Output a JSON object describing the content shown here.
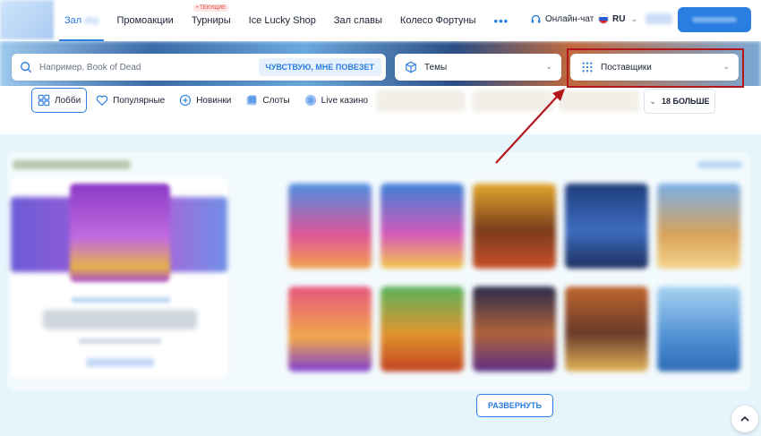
{
  "header": {
    "nav": [
      {
        "label": "Зал"
      },
      {
        "label": "Промоакции"
      },
      {
        "label": "Турниры",
        "badge": "• ТЕКУЩИЕ"
      },
      {
        "label": "Ice Lucky Shop"
      },
      {
        "label": "Зал славы"
      },
      {
        "label": "Колесо Фортуны"
      },
      {
        "label": "•••"
      }
    ],
    "chat_label": "Онлайн-чат",
    "lang": "RU"
  },
  "search": {
    "placeholder": "Например, Book of Dead",
    "lucky_button": "ЧУВСТВУЮ, МНЕ ПОВЕЗЕТ"
  },
  "filters": {
    "themes": "Темы",
    "providers": "Поставщики"
  },
  "categories": [
    {
      "label": "Лобби",
      "icon": "lobby-icon",
      "active": true
    },
    {
      "label": "Популярные",
      "icon": "heart-icon"
    },
    {
      "label": "Новинки",
      "icon": "plus-circle-icon"
    },
    {
      "label": "Слоты",
      "icon": "slots-icon"
    },
    {
      "label": "Live казино",
      "icon": "live-icon"
    }
  ],
  "more_button": "18 БОЛЬШЕ",
  "expand_button": "РАЗВЕРНУТЬ",
  "colors": {
    "accent": "#2a7de1",
    "highlight": "#b3151a"
  }
}
